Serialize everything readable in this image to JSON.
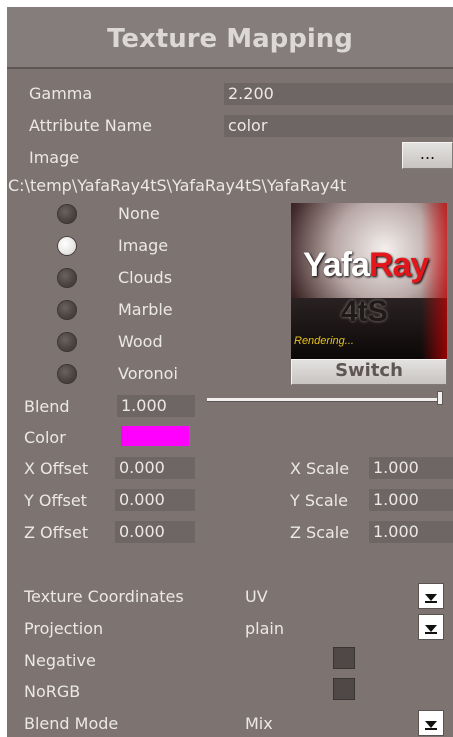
{
  "panel": {
    "title": "Texture Mapping"
  },
  "gamma": {
    "label": "Gamma",
    "value": "2.200"
  },
  "attribute_name": {
    "label": "Attribute Name",
    "value": "color"
  },
  "image": {
    "label": "Image",
    "browse_label": "...",
    "path": "C:\\temp\\YafaRay4tS\\YafaRay4tS\\YafaRay4t"
  },
  "texture_types": [
    {
      "label": "None",
      "selected": false
    },
    {
      "label": "Image",
      "selected": true
    },
    {
      "label": "Clouds",
      "selected": false
    },
    {
      "label": "Marble",
      "selected": false
    },
    {
      "label": "Wood",
      "selected": false
    },
    {
      "label": "Voronoi",
      "selected": false
    }
  ],
  "preview": {
    "logo_a": "Yafa",
    "logo_b": "Ray",
    "logo_c": "4tS",
    "status": "Rendering...",
    "switch_label": "Switch"
  },
  "blend": {
    "label": "Blend",
    "value": "1.000",
    "slider_fraction": 1.0
  },
  "color": {
    "label": "Color",
    "swatch": "#ff00ff"
  },
  "offsets": {
    "x": {
      "label": "X Offset",
      "value": "0.000"
    },
    "y": {
      "label": "Y Offset",
      "value": "0.000"
    },
    "z": {
      "label": "Z Offset",
      "value": "0.000"
    }
  },
  "scales": {
    "x": {
      "label": "X Scale",
      "value": "1.000"
    },
    "y": {
      "label": "Y Scale",
      "value": "1.000"
    },
    "z": {
      "label": "Z Scale",
      "value": "1.000"
    }
  },
  "texture_coordinates": {
    "label": "Texture Coordinates",
    "value": "UV"
  },
  "projection": {
    "label": "Projection",
    "value": "plain"
  },
  "negative": {
    "label": "Negative",
    "checked": false
  },
  "norgb": {
    "label": "NoRGB",
    "checked": false
  },
  "blend_mode": {
    "label": "Blend Mode",
    "value": "Mix"
  },
  "colors": {
    "panel_bg": "#7d7471",
    "field_bg": "#6e6664",
    "accent": "#ff00ff"
  }
}
